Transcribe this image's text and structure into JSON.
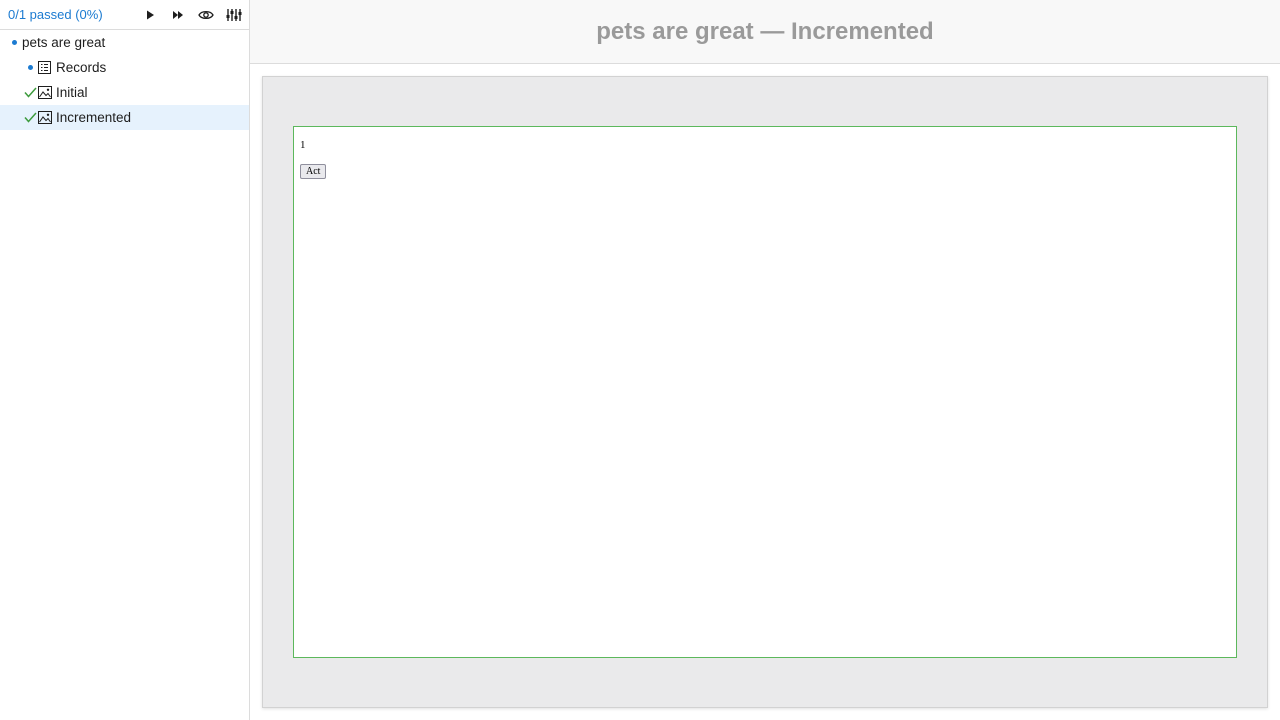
{
  "sidebar": {
    "status": "0/1 passed (0%)",
    "toolbar": {
      "run_label": "Run",
      "run_all_label": "Run all",
      "watch_label": "Watch",
      "filter_label": "Filter"
    },
    "tree": [
      {
        "label": "pets are great",
        "state": "pending",
        "icon": "dot"
      },
      {
        "label": "Records",
        "state": "pending",
        "icon": "list-icon"
      },
      {
        "label": "Initial",
        "state": "passed",
        "icon": "image-icon"
      },
      {
        "label": "Incremented",
        "state": "passed",
        "icon": "image-icon",
        "selected": true
      }
    ]
  },
  "main": {
    "title": "pets are great — Incremented",
    "preview": {
      "counter_value": "1",
      "button_label": "Act"
    }
  },
  "colors": {
    "accent": "#1c7bd1",
    "pass": "#3d9b3d",
    "preview_border": "#5cb85c",
    "title": "#9a9a9a",
    "selected_bg": "#e6f2fd"
  }
}
